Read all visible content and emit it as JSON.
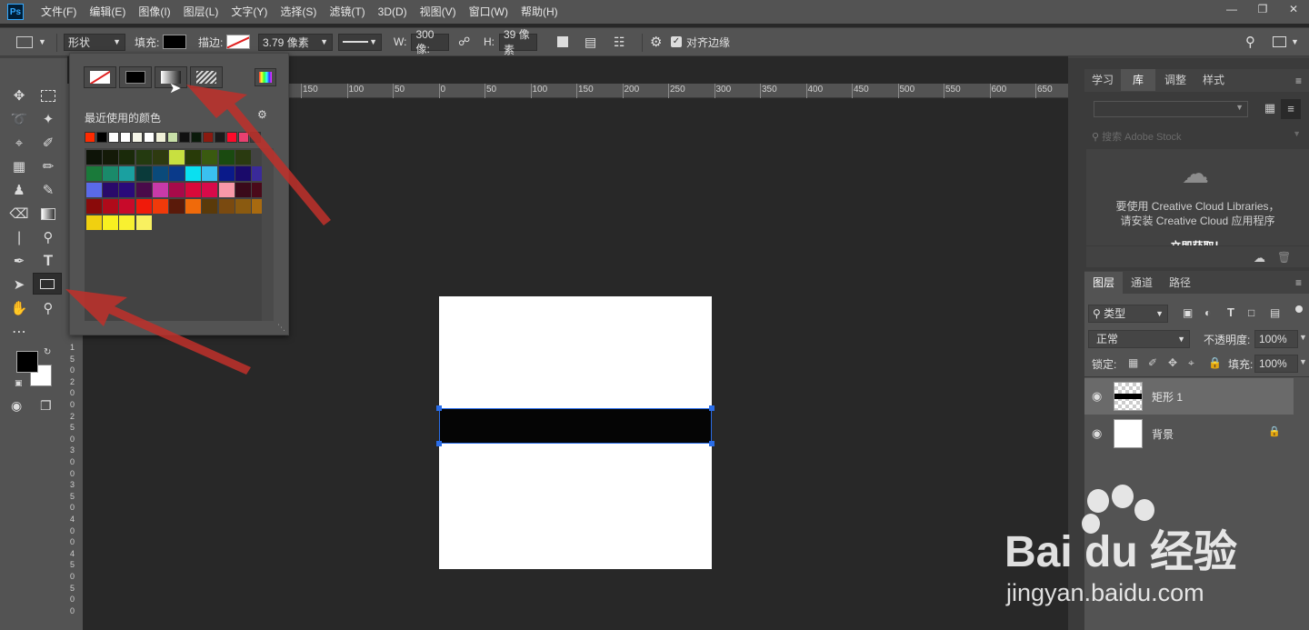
{
  "app": {
    "logo": "Ps"
  },
  "menu": [
    "文件(F)",
    "编辑(E)",
    "图像(I)",
    "图层(L)",
    "文字(Y)",
    "选择(S)",
    "滤镜(T)",
    "3D(D)",
    "视图(V)",
    "窗口(W)",
    "帮助(H)"
  ],
  "options": {
    "mode": "形状",
    "fill_label": "填充:",
    "stroke_label": "描边:",
    "stroke_width": "3.79 像素",
    "w_label": "W:",
    "w_value": "300 像:",
    "h_label": "H:",
    "h_value": "39 像素",
    "align_edges": "对齐边缘"
  },
  "popup": {
    "recent_label": "最近使用的颜色",
    "recent_colors": [
      "#ff2a00",
      "#000000",
      "#ffffff",
      "#ffffff",
      "#f5f5e8",
      "#ffffff",
      "#f0f0d8",
      "#c8e0a8",
      "#111111",
      "#0a1a0a",
      "#8a1a10",
      "#1a1a1a",
      "#ff0a2a",
      "#e84070",
      "#3b3b3b"
    ],
    "swatches": [
      [
        "#0e1408",
        "#141a08",
        "#1a2a0a",
        "#243a10",
        "#2e3a10",
        "#c8e040",
        "#283a08",
        "#3a5a10",
        "#1a4a10",
        "#2a3a10"
      ],
      [
        "#1a7a3a",
        "#1a8a6a",
        "#1aa0a0",
        "#0a3a3a",
        "#0a4a7a",
        "#0a3a8a",
        "#0ae0f0",
        "#3ac0f0",
        "#0a1a8a",
        "#1a0a6a",
        "#3a2a9a"
      ],
      [
        "#5a6ae8",
        "#2a0a6a",
        "#2a0a7a",
        "#4a0a4a",
        "#c83aa8",
        "#a80a4a",
        "#d80a3a",
        "#d80a4a",
        "#f898a8",
        "#3a0a1a",
        "#4a0a1a"
      ],
      [
        "#8a0a0a",
        "#b00a1a",
        "#c80a2a",
        "#f01a0a",
        "#f03a0a",
        "#5a1a0a",
        "#f06a0a",
        "#5a3a0a",
        "#7a4a10",
        "#8a5a10",
        "#a86a10"
      ],
      [
        "#f0d010",
        "#f8f020",
        "#f8f030",
        "#f8f060"
      ]
    ]
  },
  "ruler_top": [
    "150",
    "100",
    "50",
    "0",
    "50",
    "100",
    "150",
    "200",
    "250",
    "300",
    "350",
    "400",
    "450",
    "500",
    "550",
    "600",
    "650"
  ],
  "ruler_left": [
    "1",
    "5",
    "0",
    "2",
    "0",
    "0",
    "2",
    "5",
    "0",
    "3",
    "0",
    "0",
    "3",
    "5",
    "0",
    "4",
    "0",
    "0",
    "4",
    "5",
    "0",
    "5",
    "0",
    "0"
  ],
  "right_top_tabs": [
    "学习",
    "库",
    "调整",
    "样式"
  ],
  "library": {
    "search_placeholder": "搜索 Adobe Stock",
    "message_line1": "要使用 Creative Cloud Libraries，",
    "message_line2": "请安装 Creative Cloud 应用程序",
    "cut_text": "立即获取！"
  },
  "layer_tabs": [
    "图层",
    "通道",
    "路径"
  ],
  "layers_panel": {
    "filter_label": "类型",
    "blend_mode": "正常",
    "opacity_label": "不透明度:",
    "opacity": "100%",
    "lock_label": "锁定:",
    "fill_label": "填充:",
    "fill": "100%"
  },
  "layers": [
    {
      "name": "矩形 1",
      "selected": true
    },
    {
      "name": "背景",
      "locked": true
    }
  ],
  "watermark": {
    "brand": "Bai du 经验",
    "url": "jingyan.baidu.com"
  },
  "colors": {
    "arrow": "#c0302a",
    "selection": "#2a6de8"
  }
}
